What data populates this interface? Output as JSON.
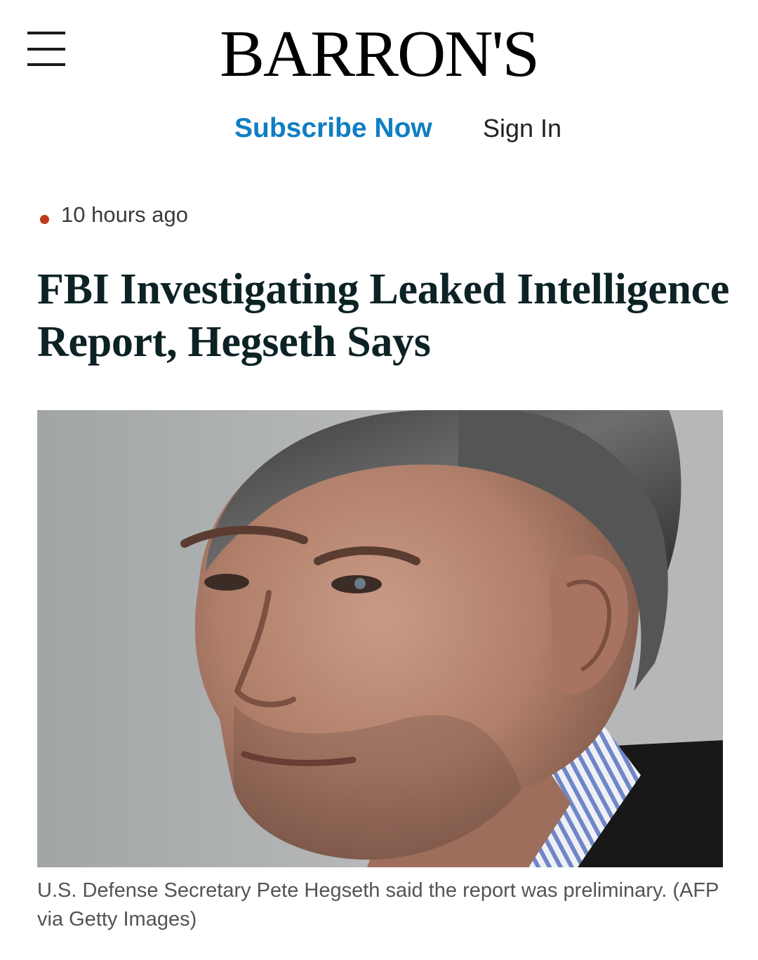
{
  "header": {
    "menu_icon": "hamburger-menu-icon",
    "logo_text": "BARRON'S",
    "subscribe_label": "Subscribe Now",
    "signin_label": "Sign In",
    "accent_color": "#0f7ec4"
  },
  "article": {
    "timestamp": "10 hours ago",
    "live_dot_color": "#c0391b",
    "headline": "FBI Investigating Leaked Intelligence Report, Hegseth Says",
    "caption": "U.S. Defense Secretary Pete Hegseth said the report was preliminary. (AFP via Getty Images)",
    "headline_color": "#0c2224"
  }
}
